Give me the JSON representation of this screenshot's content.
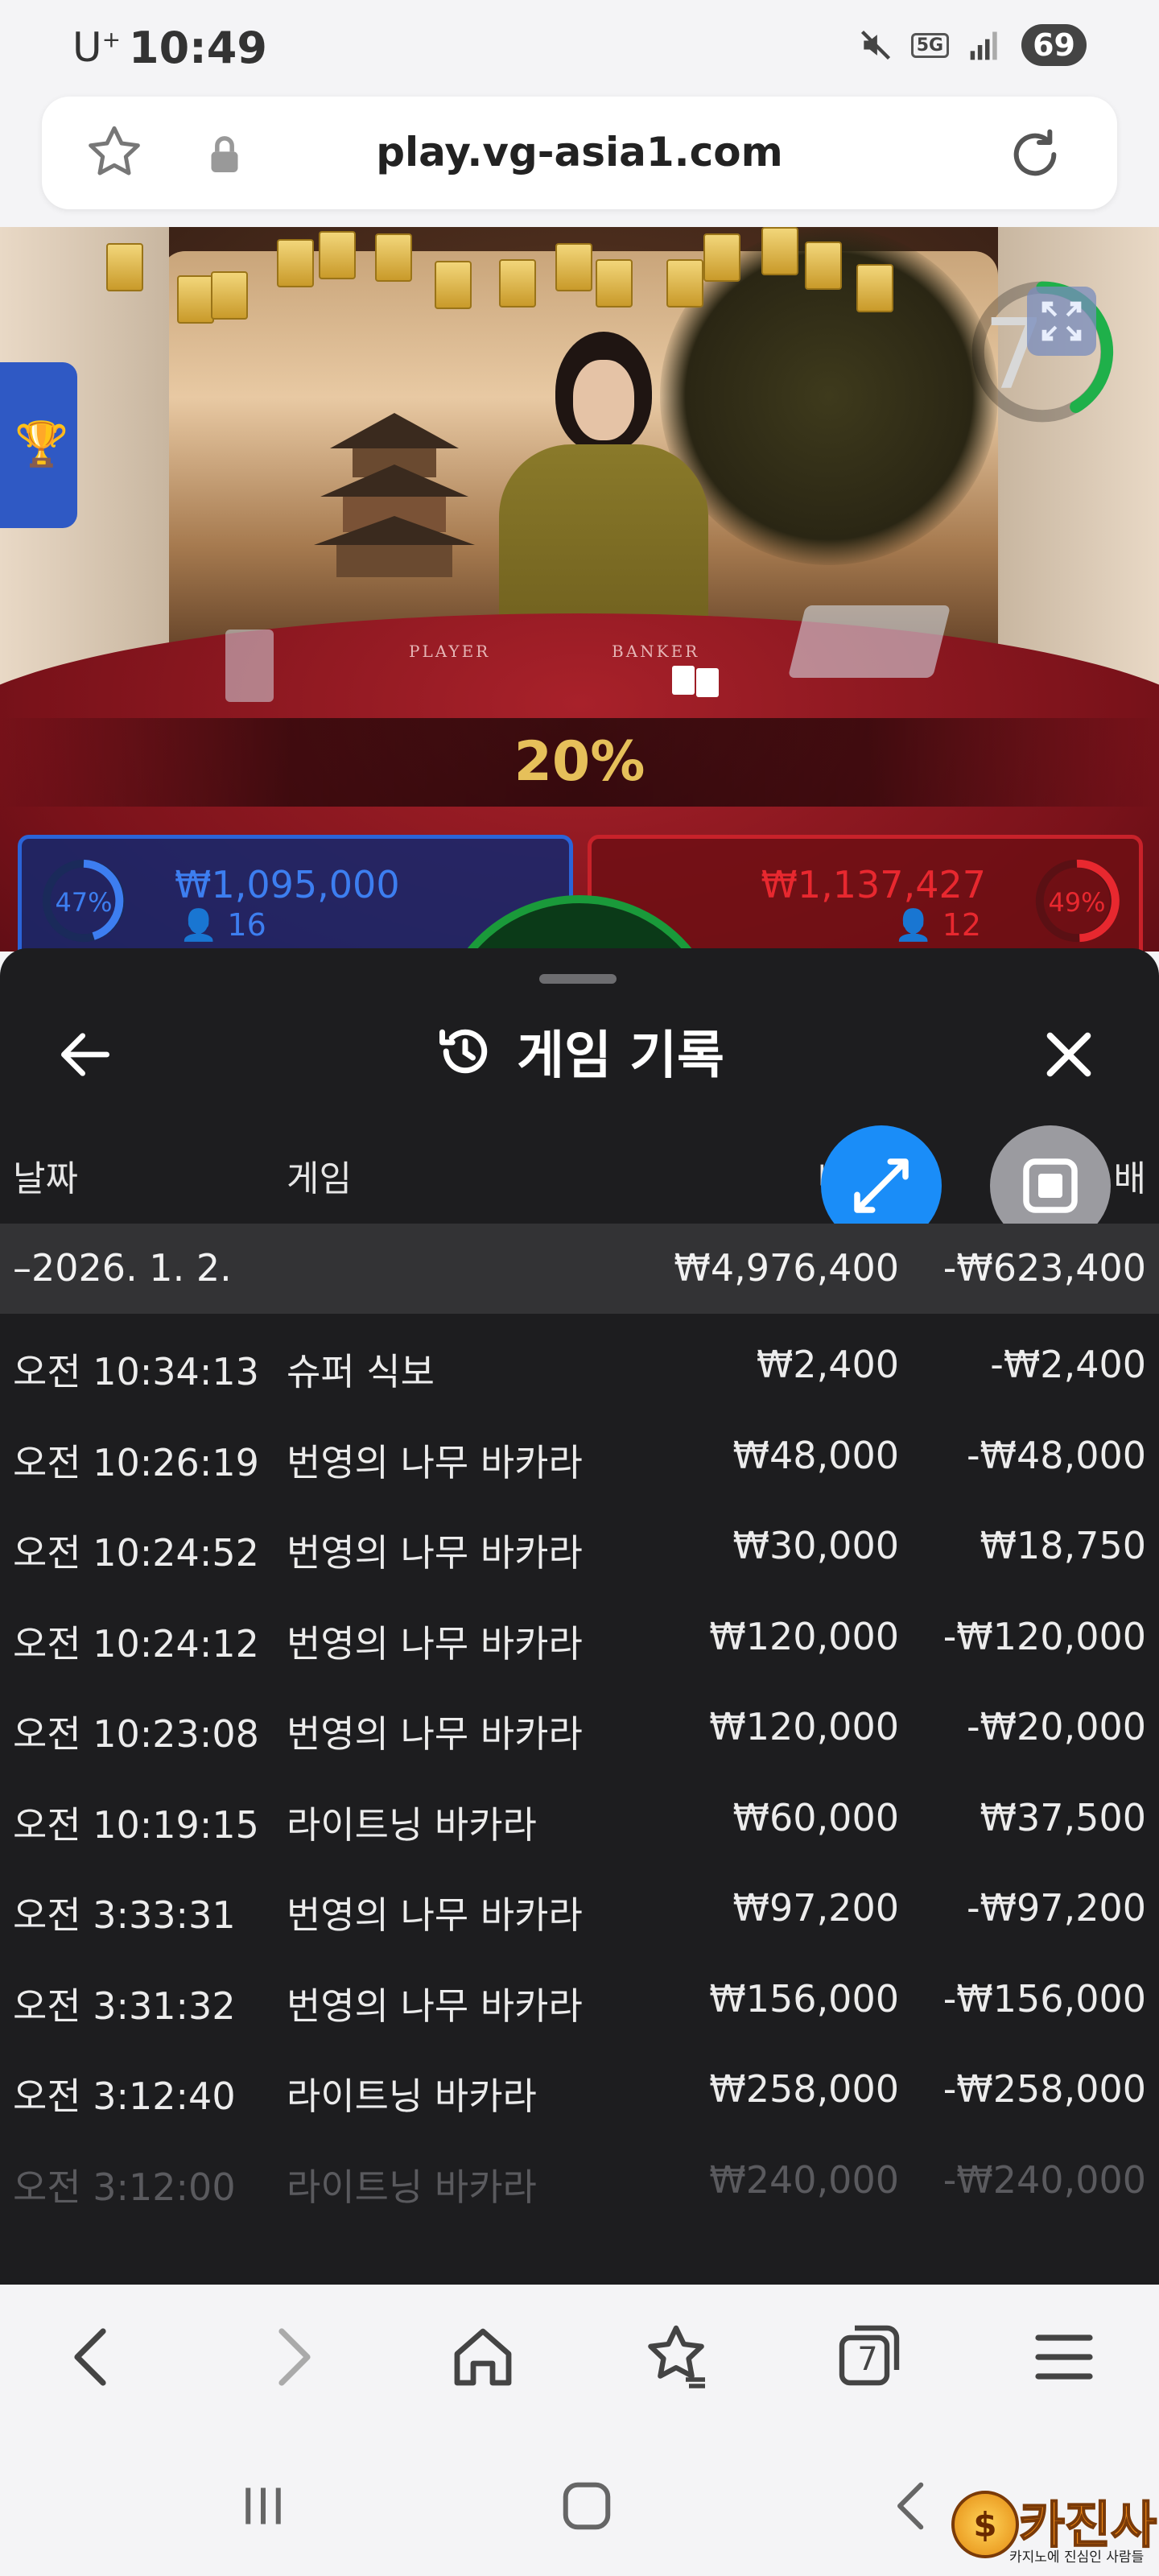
{
  "status_bar": {
    "carrier": "U",
    "carrier_sup": "+",
    "time": "10:49",
    "network": "5G",
    "battery": "69"
  },
  "browser": {
    "url": "play.vg-asia1.com",
    "tab_count": "7"
  },
  "game_view": {
    "table_labels": [
      "PLAYER",
      "BANKER"
    ],
    "progress_banner": "20%",
    "round_timer": "7",
    "player": {
      "percent": "47%",
      "amount": "₩1,095,000",
      "users": "16",
      "color": "#2b64d8"
    },
    "banker": {
      "percent": "49%",
      "amount": "₩1,137,427",
      "users": "12",
      "color": "#c8222a"
    }
  },
  "sheet": {
    "title": "게임 기록",
    "columns": {
      "date": "날짜",
      "game": "게임",
      "bet": "베팅",
      "result": "배"
    },
    "date_group": {
      "label": "–2026. 1. 2.",
      "total_bet": "₩4,976,400",
      "total_result": "-₩623,400"
    },
    "rows": [
      {
        "time": "오전 10:34:13",
        "game": "슈퍼 식보",
        "bet": "₩2,400",
        "result": "-₩2,400"
      },
      {
        "time": "오전 10:26:19",
        "game": "번영의 나무 바카라",
        "bet": "₩48,000",
        "result": "-₩48,000"
      },
      {
        "time": "오전 10:24:52",
        "game": "번영의 나무 바카라",
        "bet": "₩30,000",
        "result": "₩18,750"
      },
      {
        "time": "오전 10:24:12",
        "game": "번영의 나무 바카라",
        "bet": "₩120,000",
        "result": "-₩120,000"
      },
      {
        "time": "오전 10:23:08",
        "game": "번영의 나무 바카라",
        "bet": "₩120,000",
        "result": "-₩20,000"
      },
      {
        "time": "오전 10:19:15",
        "game": "라이트닝 바카라",
        "bet": "₩60,000",
        "result": "₩37,500"
      },
      {
        "time": "오전 3:33:31",
        "game": "번영의 나무 바카라",
        "bet": "₩97,200",
        "result": "-₩97,200"
      },
      {
        "time": "오전 3:31:32",
        "game": "번영의 나무 바카라",
        "bet": "₩156,000",
        "result": "-₩156,000"
      },
      {
        "time": "오전 3:12:40",
        "game": "라이트닝 바카라",
        "bet": "₩258,000",
        "result": "-₩258,000"
      },
      {
        "time": "오전 3:12:00",
        "game": "라이트닝 바카라",
        "bet": "₩240,000",
        "result": "-₩240,000"
      }
    ]
  },
  "watermark": {
    "logo_text": "카진사",
    "coin_text": "$",
    "tagline": "카지노에 진심인 사람들"
  },
  "colors": {
    "sheet_bg": "#1d1d1f",
    "date_row_bg": "#333335",
    "fab_blue": "#1a8df8",
    "banner_gold": "#e6c05a"
  }
}
